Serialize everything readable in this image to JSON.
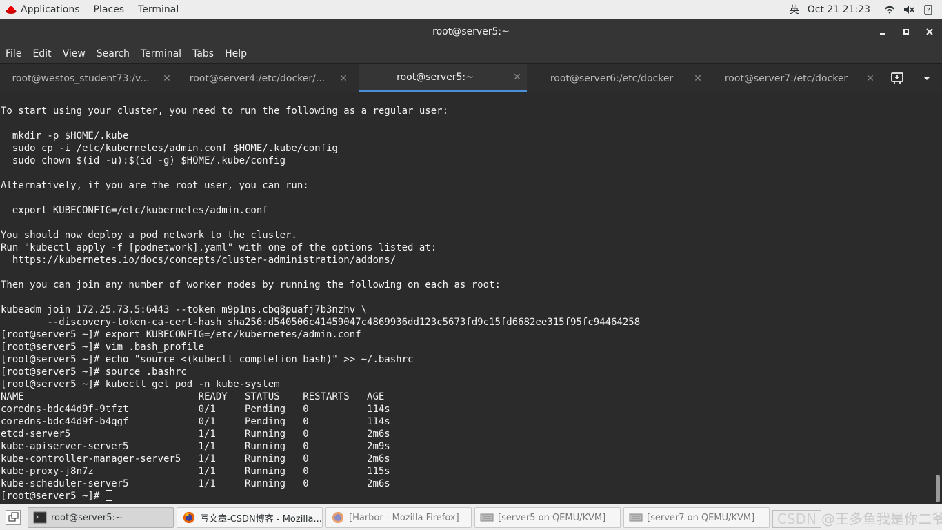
{
  "topbar": {
    "applications": "Applications",
    "places": "Places",
    "terminal": "Terminal",
    "input_method": "英",
    "clock": "Oct 21  21:23",
    "icons": [
      "wifi-icon",
      "volume-icon",
      "power-icon"
    ]
  },
  "window": {
    "title": "root@server5:~",
    "controls": [
      "minimize",
      "maximize",
      "close"
    ]
  },
  "menubar": [
    "File",
    "Edit",
    "View",
    "Search",
    "Terminal",
    "Tabs",
    "Help"
  ],
  "tabs": [
    {
      "label": "root@westos_student73:/v..."
    },
    {
      "label": "root@server4:/etc/docker/..."
    },
    {
      "label": "root@server5:~",
      "active": true
    },
    {
      "label": "root@server6:/etc/docker"
    },
    {
      "label": "root@server7:/etc/docker"
    }
  ],
  "terminal": {
    "lines": [
      "To start using your cluster, you need to run the following as a regular user:",
      "",
      "  mkdir -p $HOME/.kube",
      "  sudo cp -i /etc/kubernetes/admin.conf $HOME/.kube/config",
      "  sudo chown $(id -u):$(id -g) $HOME/.kube/config",
      "",
      "Alternatively, if you are the root user, you can run:",
      "",
      "  export KUBECONFIG=/etc/kubernetes/admin.conf",
      "",
      "You should now deploy a pod network to the cluster.",
      "Run \"kubectl apply -f [podnetwork].yaml\" with one of the options listed at:",
      "  https://kubernetes.io/docs/concepts/cluster-administration/addons/",
      "",
      "Then you can join any number of worker nodes by running the following on each as root:",
      "",
      "kubeadm join 172.25.73.5:6443 --token m9p1ns.cbq8puafj7b3nzhv \\",
      "        --discovery-token-ca-cert-hash sha256:d540506c41459047c4869936dd123c5673fd9c15fd6682ee315f95fc94464258",
      "[root@server5 ~]# export KUBECONFIG=/etc/kubernetes/admin.conf",
      "[root@server5 ~]# vim .bash_profile",
      "[root@server5 ~]# echo \"source <(kubectl completion bash)\" >> ~/.bashrc",
      "[root@server5 ~]# source .bashrc",
      "[root@server5 ~]# kubectl get pod -n kube-system",
      "NAME                              READY   STATUS    RESTARTS   AGE",
      "coredns-bdc44d9f-9tfzt            0/1     Pending   0          114s",
      "coredns-bdc44d9f-b4qgf            0/1     Pending   0          114s",
      "etcd-server5                      1/1     Running   0          2m6s",
      "kube-apiserver-server5            1/1     Running   0          2m9s",
      "kube-controller-manager-server5   1/1     Running   0          2m6s",
      "kube-proxy-j8n7z                  1/1     Running   0          115s",
      "kube-scheduler-server5            1/1     Running   0          2m6s"
    ],
    "prompt": "[root@server5 ~]# "
  },
  "taskbar": {
    "items": [
      {
        "label": "root@server5:~",
        "icon": "terminal-icon",
        "active": true
      },
      {
        "label": "写文章-CSDN博客 - Mozilla...",
        "icon": "firefox-icon"
      },
      {
        "label": "[Harbor - Mozilla Firefox]",
        "icon": "firefox-icon",
        "dim": true
      },
      {
        "label": "[server5 on QEMU/KVM]",
        "icon": "vm-icon",
        "dim": true
      },
      {
        "label": "[server7 on QEMU/KVM]",
        "icon": "vm-icon",
        "dim": true
      }
    ],
    "watermark_badge": "CSDN",
    "watermark_text": "@王多鱼我是你二爷"
  }
}
